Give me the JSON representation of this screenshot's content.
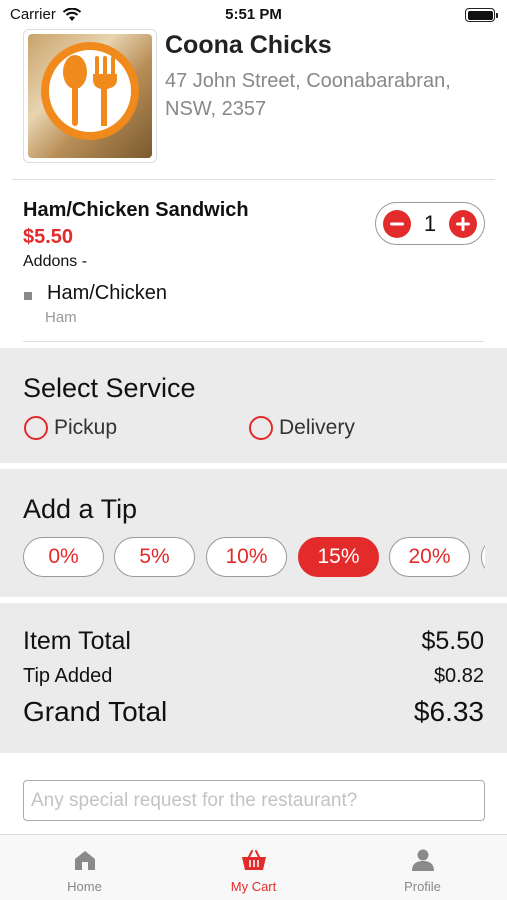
{
  "status_bar": {
    "carrier": "Carrier",
    "time": "5:51 PM"
  },
  "restaurant": {
    "name": "Coona Chicks",
    "address": "47 John Street, Coonabarabran, NSW, 2357",
    "logo_icon": "fork-spoon-icon"
  },
  "cart_item": {
    "name": "Ham/Chicken Sandwich",
    "price": "$5.50",
    "addons_label": "Addons -",
    "addon_name": "Ham/Chicken",
    "addon_option": "Ham",
    "quantity": "1",
    "minus_icon": "minus-icon",
    "plus_icon": "plus-icon"
  },
  "service": {
    "title": "Select Service",
    "options": [
      "Pickup",
      "Delivery"
    ]
  },
  "tip": {
    "title": "Add a Tip",
    "options": [
      "0%",
      "5%",
      "10%",
      "15%",
      "20%"
    ],
    "selected": "15%"
  },
  "totals": {
    "item_total_label": "Item Total",
    "item_total_value": "$5.50",
    "tip_label": "Tip Added",
    "tip_value": "$0.82",
    "grand_label": "Grand Total",
    "grand_value": "$6.33"
  },
  "request": {
    "placeholder": "Any special request for the restaurant?"
  },
  "tabs": [
    {
      "label": "Home",
      "icon": "home-icon"
    },
    {
      "label": "My Cart",
      "icon": "basket-icon",
      "active": true
    },
    {
      "label": "Profile",
      "icon": "person-icon"
    }
  ],
  "colors": {
    "accent": "#e32b2b",
    "logo_orange": "#f08a1c"
  }
}
